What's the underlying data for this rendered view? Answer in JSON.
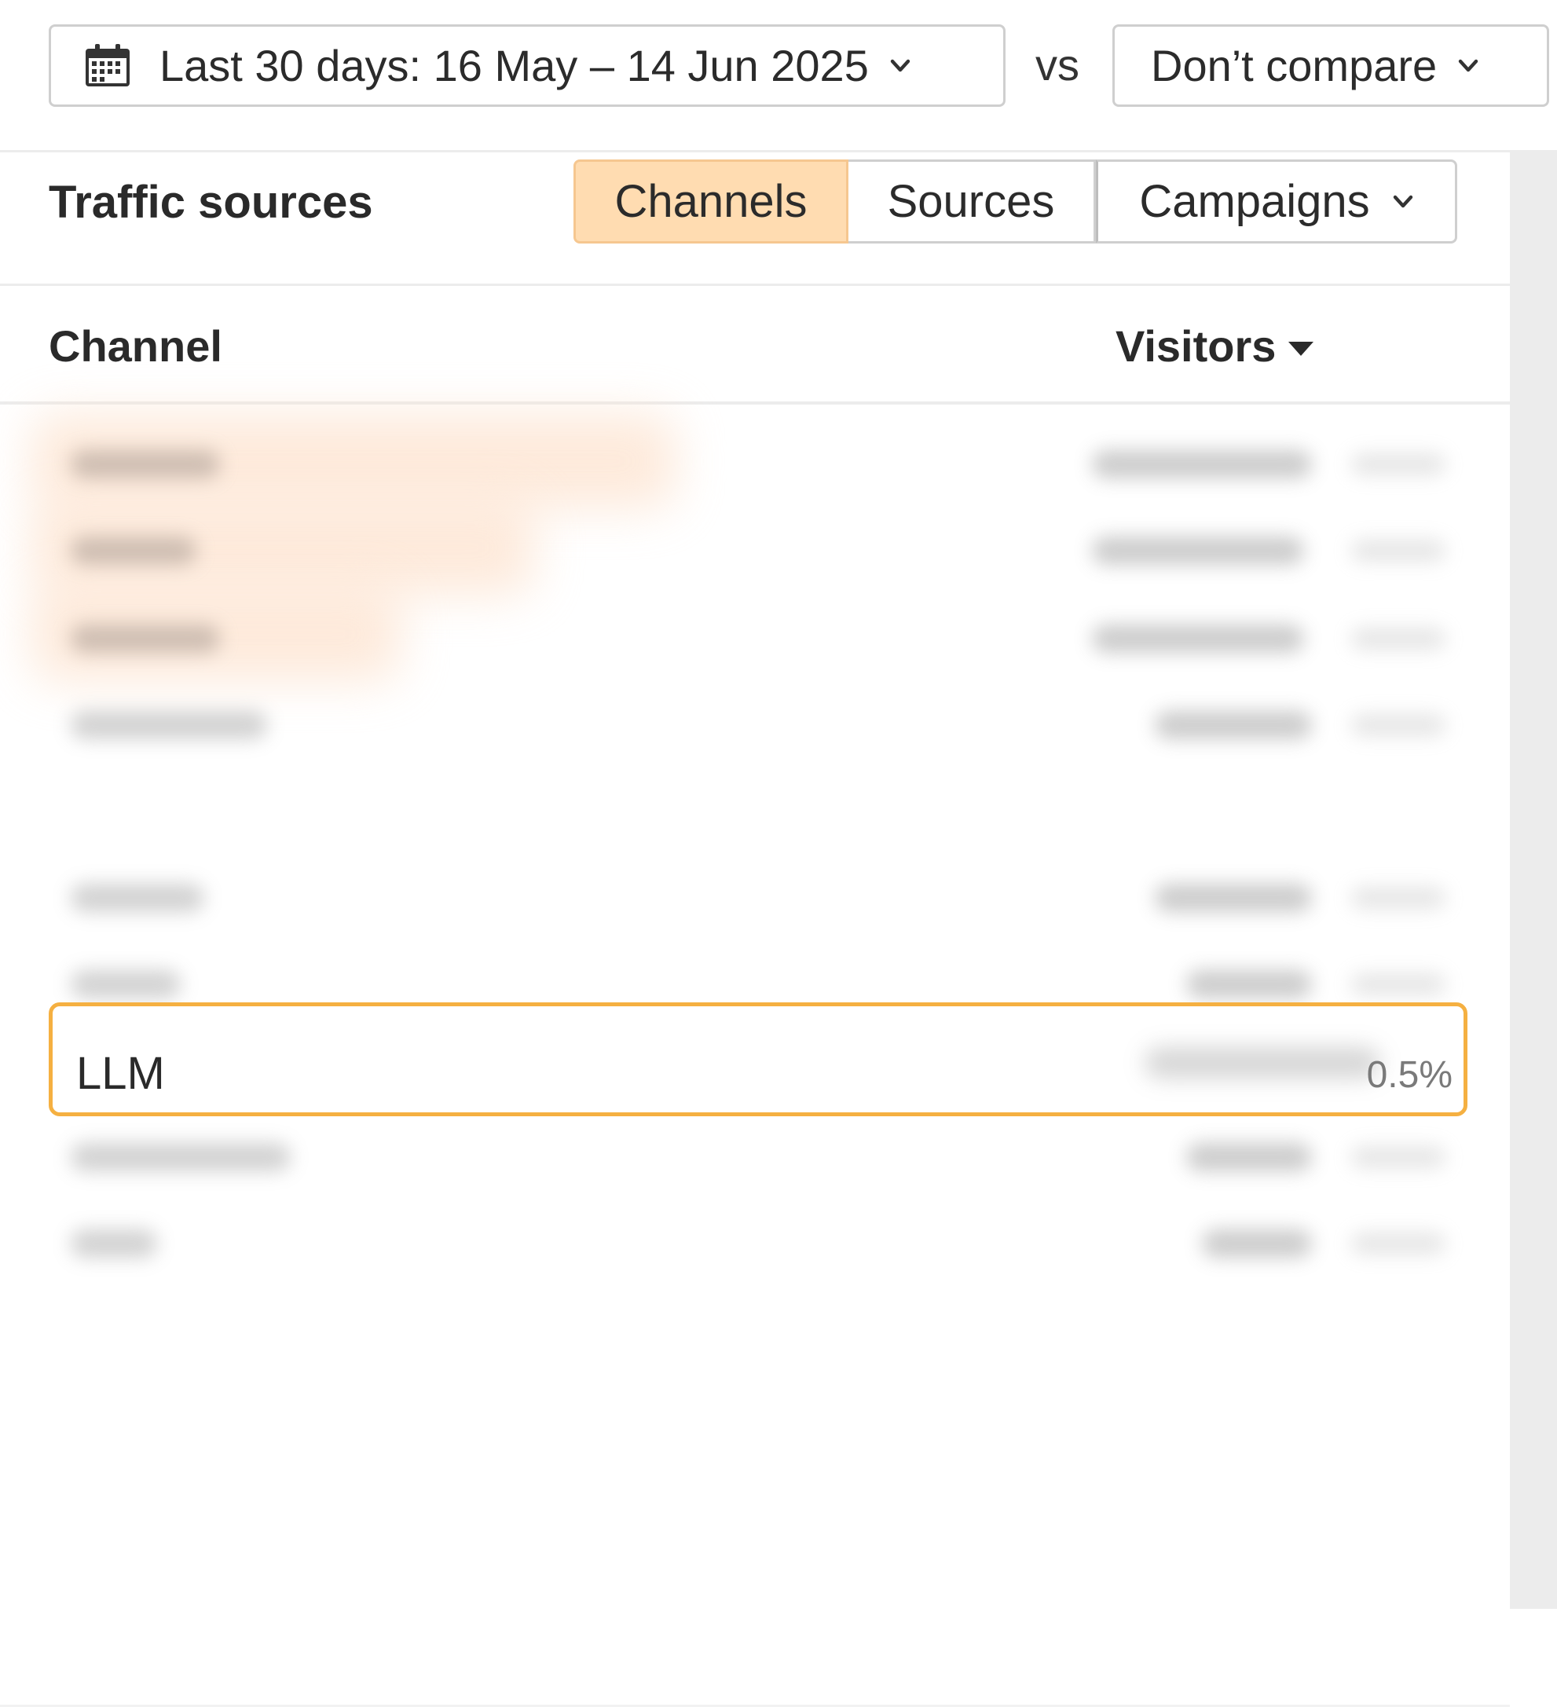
{
  "filters": {
    "date_range_label": "Last 30 days: 16 May – 14 Jun 2025",
    "vs_label": "vs",
    "compare_label": "Don’t compare"
  },
  "panel": {
    "title": "Traffic sources",
    "tabs": [
      {
        "label": "Channels",
        "active": true
      },
      {
        "label": "Sources",
        "active": false
      },
      {
        "label": "Campaigns",
        "active": false
      }
    ]
  },
  "table": {
    "columns": {
      "channel": "Channel",
      "visitors": "Visitors"
    },
    "highlighted_row": {
      "channel": "LLM",
      "share": "0.5%"
    }
  },
  "icons": {
    "date": "calendar-icon",
    "dropdown": "chevron-down-icon",
    "sort": "sort-desc-icon"
  },
  "colors": {
    "active_tab_bg": "#ffdcb1",
    "highlight_border": "#f5b041"
  }
}
